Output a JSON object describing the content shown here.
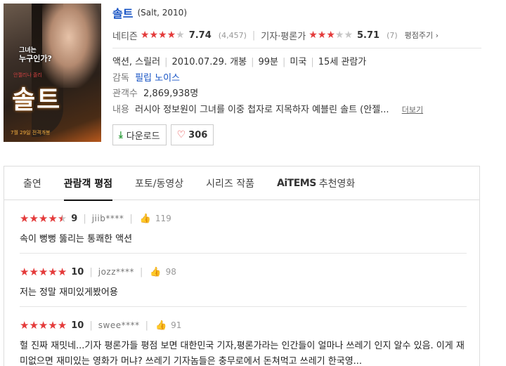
{
  "poster": {
    "tagline_1": "그녀는",
    "tagline_2": "누구인가?",
    "credit": "안젤리나 졸리",
    "title_text": "솔트",
    "release_note": "7월 29일 전격개봉"
  },
  "movie": {
    "title": "솔트",
    "subtitle": "(Salt, 2010)"
  },
  "ratings": {
    "netizen_label": "네티즌",
    "netizen_stars": 4,
    "netizen_score": "7.74",
    "netizen_count": "(4,457)",
    "critic_label": "기자·평론가",
    "critic_stars": 3,
    "critic_score": "5.71",
    "critic_count": "(7)",
    "rate_link": "평점주기",
    "rate_arrow": "›"
  },
  "meta": {
    "genre": "액션, 스릴러",
    "release": "2010.07.29. 개봉",
    "runtime": "99분",
    "country": "미국",
    "age": "15세 관람가",
    "director_label": "감독",
    "director": "필립 노이스",
    "audience_label": "관객수",
    "audience": "2,869,938명",
    "plot_label": "내용",
    "plot": "러시아 정보원이 그녀를 이중 첩자로 지목하자 예블린 솔트 (안젤...",
    "more": "더보기"
  },
  "buttons": {
    "download": "다운로드",
    "like_count": "306"
  },
  "tabs": [
    {
      "label": "출연"
    },
    {
      "label": "관람객 평점"
    },
    {
      "label": "포토/동영상"
    },
    {
      "label": "시리즈 작품"
    },
    {
      "label": "추천영화",
      "brand": "AiTEMS"
    }
  ],
  "reviews": [
    {
      "score": "9",
      "stars": 4.5,
      "user": "jiib****",
      "likes": "119",
      "text": "속이 뻥뻥 뚫리는 통쾌한 액션"
    },
    {
      "score": "10",
      "stars": 5,
      "user": "jozz****",
      "likes": "98",
      "text": "저는 정말 재미있게봤어용"
    },
    {
      "score": "10",
      "stars": 5,
      "user": "swee****",
      "likes": "91",
      "text": "헐 진짜 재밋네...기자 평론가들 평점 보면 대한민국 기자,평론가라는 인간들이 얼마나 쓰레기 인지 알수 있음. 이게 재미없으면 재미있는 영화가 머냐? 쓰레기 기자놈들은 충무로에서 돈쳐먹고 쓰레기 한국영..."
    }
  ]
}
